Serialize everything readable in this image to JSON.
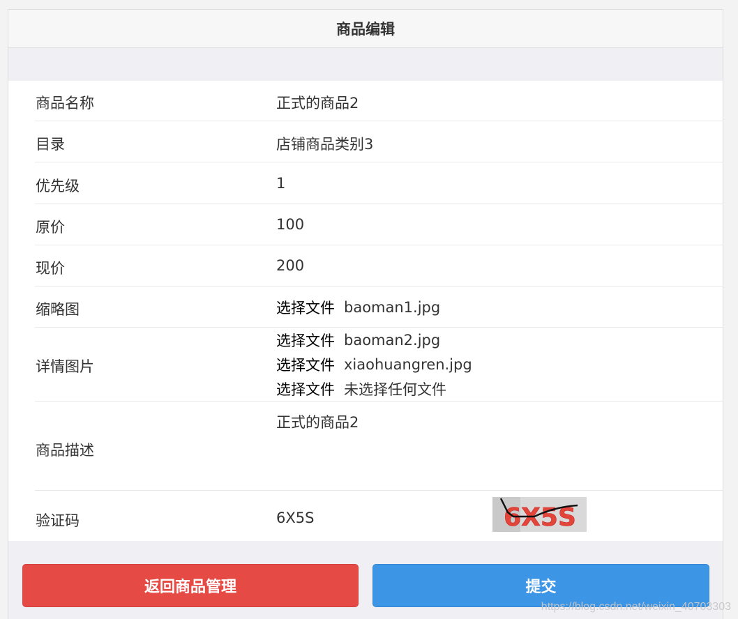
{
  "header": {
    "title": "商品编辑"
  },
  "form": {
    "name": {
      "label": "商品名称",
      "value": "正式的商品2"
    },
    "category": {
      "label": "目录",
      "value": "店铺商品类别3"
    },
    "priority": {
      "label": "优先级",
      "value": "1"
    },
    "original_price": {
      "label": "原价",
      "value": "100"
    },
    "current_price": {
      "label": "现价",
      "value": "200"
    },
    "thumbnail": {
      "label": "缩略图",
      "button": "选择文件",
      "file": "baoman1.jpg"
    },
    "detail_images": {
      "label": "详情图片",
      "files": [
        {
          "button": "选择文件",
          "file": "baoman2.jpg"
        },
        {
          "button": "选择文件",
          "file": "xiaohuangren.jpg"
        },
        {
          "button": "选择文件",
          "file": "未选择任何文件"
        }
      ]
    },
    "description": {
      "label": "商品描述",
      "value": "正式的商品2"
    },
    "captcha": {
      "label": "验证码",
      "value": "6X5S",
      "image_text": "6X5S"
    }
  },
  "actions": {
    "back_label": "返回商品管理",
    "submit_label": "提交"
  },
  "watermark": "https://blog.csdn.net/weixin_40703303",
  "colors": {
    "back": "#e54a45",
    "submit": "#3d95e6"
  }
}
